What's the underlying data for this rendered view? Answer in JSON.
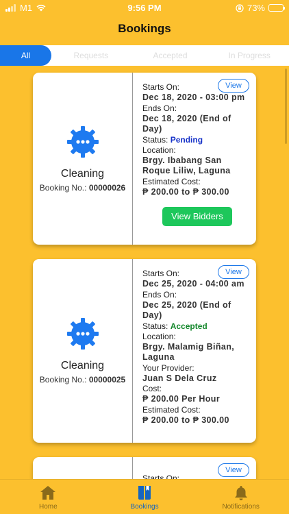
{
  "status_bar": {
    "carrier": "M1",
    "time": "9:56 PM",
    "battery": "73%"
  },
  "header": {
    "title": "Bookings"
  },
  "tabs": [
    {
      "label": "All",
      "active": true
    },
    {
      "label": "Requests",
      "active": false
    },
    {
      "label": "Accepted",
      "active": false
    },
    {
      "label": "In Progress",
      "active": false
    }
  ],
  "labels": {
    "starts_on": "Starts On:",
    "ends_on": "Ends On:",
    "status": "Status:",
    "location": "Location:",
    "provider": "Your Provider:",
    "cost": "Cost:",
    "estimated_cost": "Estimated Cost:",
    "booking_no": "Booking No.:",
    "view": "View",
    "view_bidders": "View Bidders"
  },
  "bookings": [
    {
      "service": "Cleaning",
      "booking_no": "00000026",
      "starts_on": "Dec 18, 2020 - 03:00 pm",
      "ends_on": "Dec 18, 2020 (End of Day)",
      "status": "Pending",
      "location": "Brgy. Ibabang San Roque Liliw, Laguna",
      "estimated_cost": "₱ 200.00 to ₱ 300.00"
    },
    {
      "service": "Cleaning",
      "booking_no": "00000025",
      "starts_on": "Dec 25, 2020 - 04:00 am",
      "ends_on": "Dec 25, 2020 (End of Day)",
      "status": "Accepted",
      "location": "Brgy. Malamig Biñan, Laguna",
      "provider": "Juan S Dela Cruz",
      "cost": "₱ 200.00 Per Hour",
      "estimated_cost": "₱ 200.00 to ₱ 300.00"
    },
    {
      "starts_on_partial": "Starts On:"
    }
  ],
  "bottom_nav": [
    {
      "label": "Home",
      "icon": "home-icon",
      "active": false
    },
    {
      "label": "Bookings",
      "icon": "book-icon",
      "active": true
    },
    {
      "label": "Notifications",
      "icon": "bell-icon",
      "active": false
    }
  ],
  "colors": {
    "background": "#FCC02E",
    "accent": "#1976E8",
    "pending": "#1531C8",
    "accepted": "#14882C",
    "button_green": "#1DC75B"
  }
}
